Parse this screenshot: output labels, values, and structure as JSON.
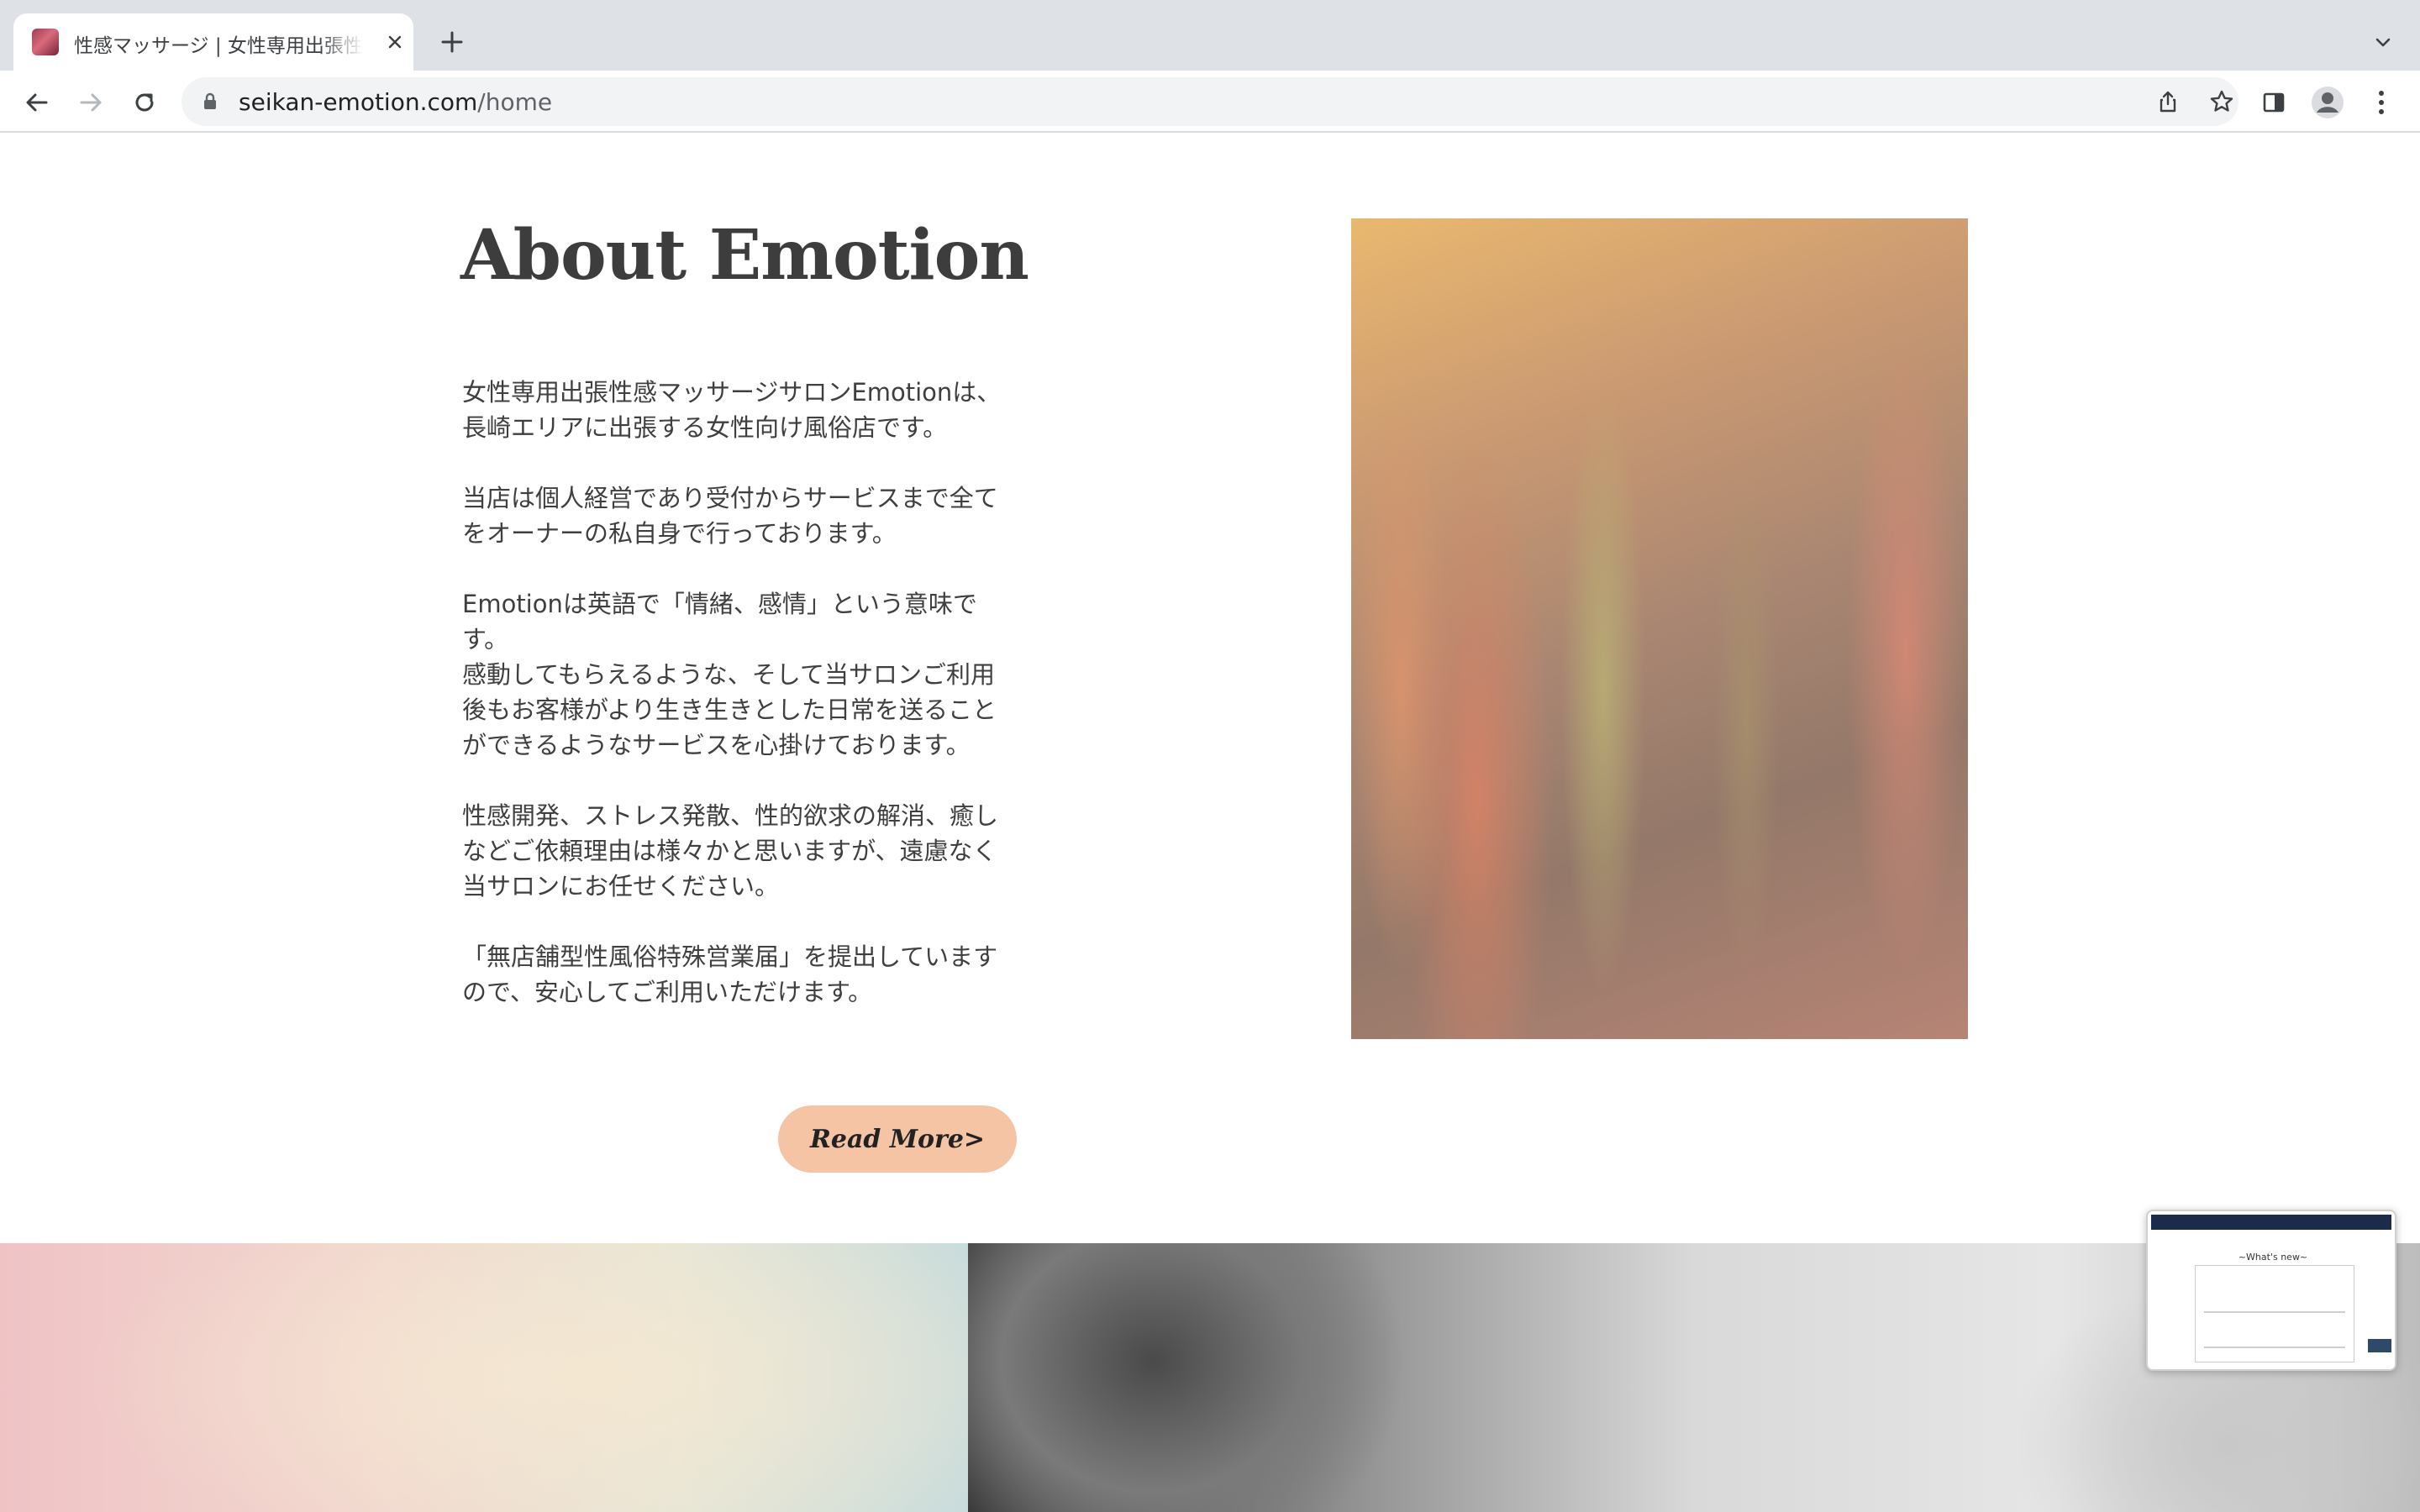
{
  "browser": {
    "tab_title": "性感マッサージ | 女性専用出張性感",
    "url_domain": "seikan-emotion.com",
    "url_path": "/home"
  },
  "about": {
    "heading": "About Emotion",
    "paragraphs": [
      [
        "女性専用出張性感マッサージサロンEmotionは、",
        "長崎エリアに出張する女性向け風俗店です。"
      ],
      [
        "当店は個人経営であり受付からサービスまで全て",
        "をオーナーの私自身で行っております。"
      ],
      [
        "Emotionは英語で「情緒、感情」という意味で",
        "す。",
        "感動してもらえるような、そして当サロンご利用",
        "後もお客様がより生き生きとした日常を送ること",
        "ができるようなサービスを心掛けております。"
      ],
      [
        "性感開発、ストレス発散、性的欲求の解消、癒し",
        "などご依頼理由は様々かと思いますが、遠慮なく",
        "当サロンにお任せください。"
      ],
      [
        "「無店舗型性風俗特殊営業届」を提出しています",
        "ので、安心してご利用いただけます。"
      ]
    ],
    "read_more": "Read More>"
  },
  "preview": {
    "title": "~What's new~"
  },
  "colors": {
    "button": "#f4c4a4",
    "heading": "#3d3d3d",
    "body_text": "#3f3f3f"
  }
}
